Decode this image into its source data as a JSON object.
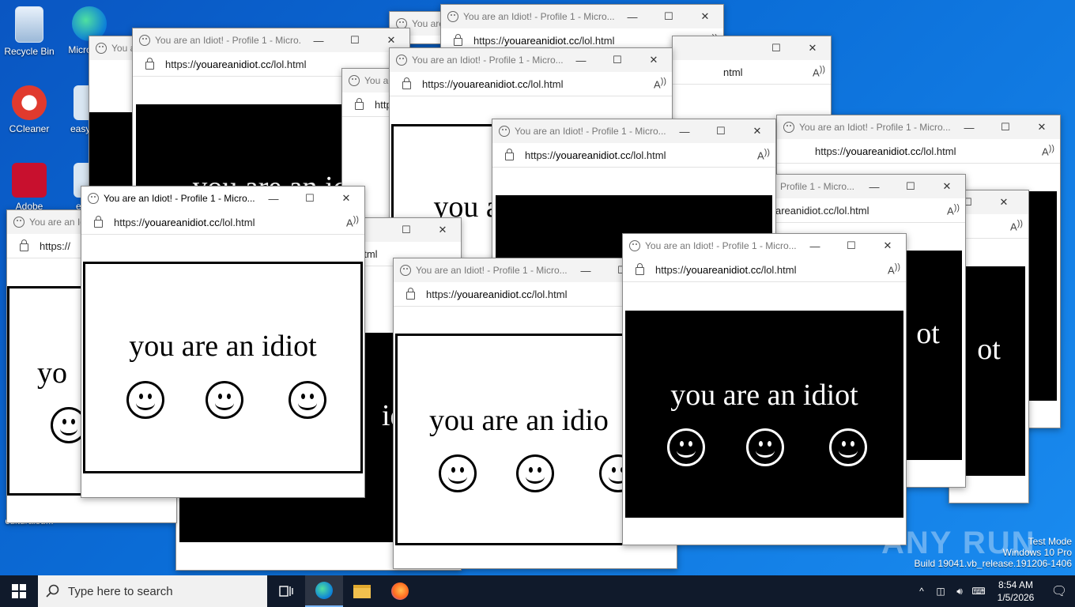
{
  "desktop": {
    "icons": [
      {
        "label": "Recycle Bin"
      },
      {
        "label": "Micros Ed"
      },
      {
        "label": "CCleaner"
      },
      {
        "label": "easync"
      },
      {
        "label": "Adobe"
      },
      {
        "label": "euro"
      },
      {
        "label": "culturalsu..."
      }
    ]
  },
  "window": {
    "title": "You are an Idiot! - Profile 1 - Micro...",
    "title_partial_a": "You are an Idio",
    "title_partial_b": "You are an Idi",
    "title_partial_c": "Profile 1 - Micro...",
    "url_prefix": "https://",
    "url_domain": "youareanidiot.cc",
    "url_path": "/lol.html",
    "url_partial": "areanidiot.cc/lol.html",
    "url_partial_b": "ntml",
    "url_partial_c": "html",
    "url_short": "https://",
    "message": "you are an idiot",
    "message_partial_a": "you are an id",
    "message_partial_b": "you are an idio",
    "message_partial_c": "you a",
    "message_partial_d": "yo",
    "message_partial_e": "ot",
    "message_partial_f": "idi",
    "reader_icon": "read-aloud-icon",
    "minimize": "—",
    "maximize": "☐",
    "close": "✕"
  },
  "taskbar": {
    "search_placeholder": "Type here to search",
    "time": "8:54 AM",
    "date": "1/5/2026"
  },
  "watermark": {
    "line1": "Test Mode",
    "line2": "Windows 10 Pro",
    "line3": "Build 19041.vb_release.191206-1406",
    "brand": "ANY RUN"
  },
  "colors": {
    "accent": "#0b6ed8",
    "taskbar": "#101a2b"
  }
}
